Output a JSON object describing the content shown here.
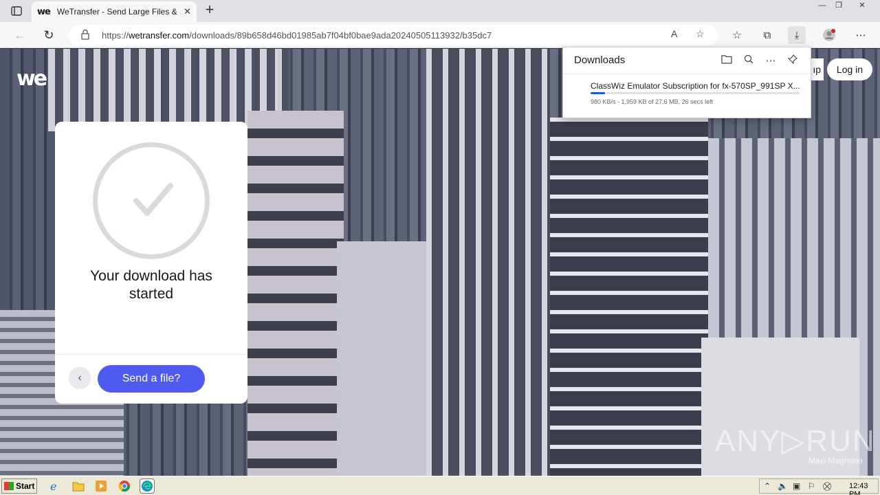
{
  "browser": {
    "tab_title": "WeTransfer - Send Large Files & S",
    "tab_close": "✕",
    "new_tab": "+",
    "url_prefix": "https://",
    "url_host": "wetransfer.com",
    "url_path": "/downloads/89b658d46bd01985ab7f04bf0bae9ada20240505113932/b35dc7",
    "window_controls": [
      "—",
      "❐",
      "✕"
    ]
  },
  "page": {
    "logo": "we",
    "signup_partial": "ıp",
    "login_label": "Log in",
    "card": {
      "heading_line1": "Your download has",
      "heading_line2": "started",
      "back_label": "‹",
      "send_label": "Send a file?"
    },
    "watermark": "ANY▷RUN",
    "watermark_sub": "Maxi Magnano"
  },
  "downloads_panel": {
    "title": "Downloads",
    "file_name": "ClassWiz Emulator Subscription for fx-570SP_991SP X...",
    "status": "980 KB/s - 1,959 KB of 27.6 MB, 26 secs left",
    "progress_fraction": 0.07
  },
  "taskbar": {
    "start_label": "Start",
    "clock": "12:43 PM"
  },
  "colors": {
    "accent": "#4f5bf0",
    "progress": "#0a66d8"
  }
}
